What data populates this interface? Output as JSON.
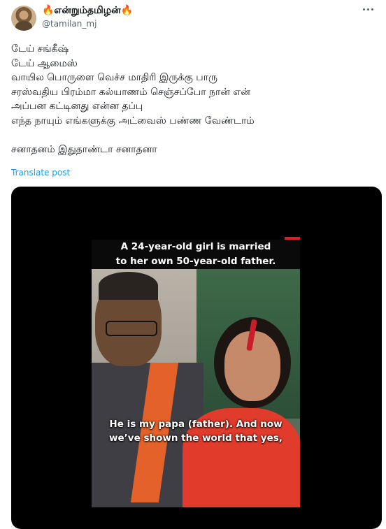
{
  "author": {
    "display_name": "🔥என்றும்தமிழன்🔥",
    "handle": "@tamilan_mj"
  },
  "post": {
    "lines": [
      "டேய் சங்கீஷ்",
      "டேய் ஆமைஸ்",
      "வாயில பொருளை வெச்ச மாதிரி இருக்கு பாரு",
      "சரஸ்வதிய பிரம்மா கல்யாணம் செஞ்சப்போ நான் என்",
      "அப்பன கட்டினது என்ன தப்பு",
      "எந்த நாயும் எங்களுக்கு அட்வைஸ் பண்ண வேண்டாம்",
      "",
      "சனாதனம் இதுதாண்டா சனாதனா"
    ],
    "translate_label": "Translate post"
  },
  "video": {
    "caption_top_line1": "A 24-year-old girl is married",
    "caption_top_line2": "to her own 50-year-old father.",
    "caption_bottom_line1": "He is my papa (father). And now",
    "caption_bottom_line2": "we’ve shown the world that yes,"
  },
  "icons": {
    "more": "more-options-icon"
  }
}
